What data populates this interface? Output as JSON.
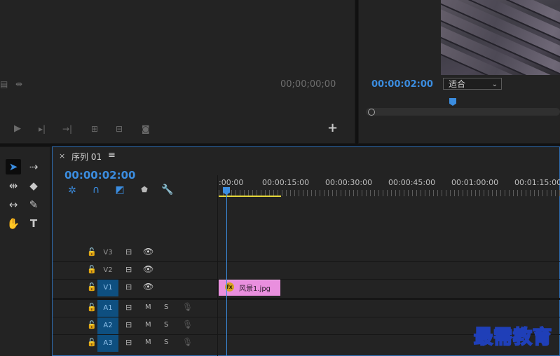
{
  "source_monitor": {
    "timecode": "00;00;00;00",
    "add_button": "+"
  },
  "program_monitor": {
    "timecode": "00:00:02:00",
    "fit_dropdown": {
      "selected": "适合"
    }
  },
  "timeline": {
    "tab_close": "×",
    "sequence_name": "序列 01",
    "tab_menu": "≡",
    "timecode": "00:00:02:00",
    "ruler_labels": [
      ":00:00",
      "00:00:15:00",
      "00:00:30:00",
      "00:00:45:00",
      "00:01:00:00",
      "00:01:15:00"
    ],
    "tracks": {
      "video": [
        {
          "name": "V3",
          "targeted": false
        },
        {
          "name": "V2",
          "targeted": false
        },
        {
          "name": "V1",
          "targeted": true
        }
      ],
      "audio": [
        {
          "name": "A1",
          "mute": "M",
          "solo": "S"
        },
        {
          "name": "A2",
          "mute": "M",
          "solo": "S"
        },
        {
          "name": "A3",
          "mute": "M",
          "solo": "S"
        }
      ]
    },
    "clip": {
      "fx_badge": "fx",
      "name": "风景1.jpg",
      "color": "#e98fde"
    }
  },
  "watermark": "最需教育",
  "colors": {
    "accent": "#3b8de0",
    "work_area": "#e6d83a",
    "track_target": "#0e4f80"
  },
  "icons": {
    "tools": [
      "selection-icon",
      "track-select-icon",
      "ripple-edit-icon",
      "razor-icon",
      "slip-icon",
      "pen-icon",
      "hand-icon",
      "type-icon"
    ]
  }
}
